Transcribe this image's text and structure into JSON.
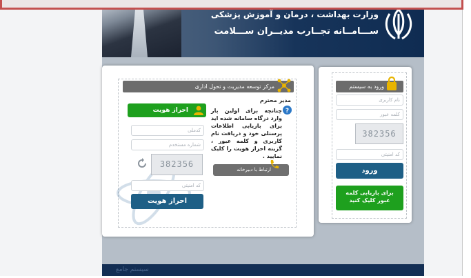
{
  "header": {
    "ministry": "وزارت بهداشت ، درمان و آموزش پزشکی",
    "system": "ســـامــانه تجــارب مدیــران ســـلامت"
  },
  "login": {
    "title": "ورود به سیستم",
    "username_placeholder": "نام کاربری",
    "password_placeholder": "کلمه عبور",
    "captcha": "382356",
    "captcha_input_placeholder": "کد امنیتی",
    "submit_label": "ورود",
    "recover_label": "برای بازیابی کلمه عبور کلیک کنید"
  },
  "center": {
    "title": "مرکز توسعه مدیریت و تحول اداری",
    "heading": "مدیر محترم",
    "message": "چنانچه برای اولین بار وارد درگاه سامانه شده اید برای بازیابی اطلاعات پرسنلی خود و دریافت نام کاربری و کلمه عبور ، گزینه احراز هویت را کلیک نمایید .",
    "contact_label": "ارتباط با دبیرخانه"
  },
  "auth": {
    "title": "احراز هویت",
    "national_code_placeholder": "کدملی",
    "personnel_number_placeholder": "شماره مستخدم",
    "captcha": "382356",
    "captcha_input_placeholder": "کد امنیتی",
    "submit_label": "احراز هویت"
  },
  "footer": {
    "text": "سیستم جامع"
  },
  "colors": {
    "header_dark": "#0f2c52",
    "accent_blue": "#1e5f86",
    "accent_green": "#1ea01e",
    "title_gray": "#6c6c6c",
    "icon_gold": "#e8b400",
    "annotation_red": "#c3504f"
  }
}
